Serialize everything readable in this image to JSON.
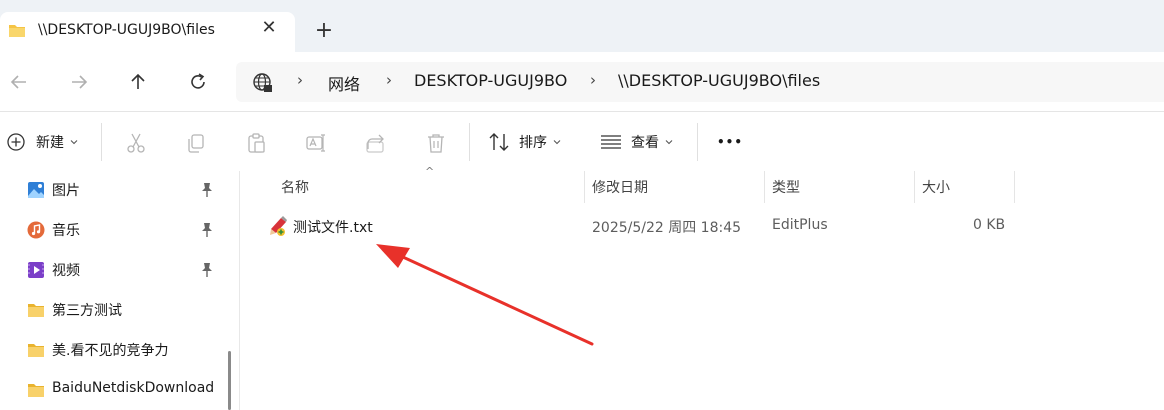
{
  "tab": {
    "title": "\\\\DESKTOP-UGUJ9BO\\files",
    "close_glyph": "✕",
    "new_tab_glyph": "+"
  },
  "nav": {
    "back_icon": "arrow-left-icon",
    "forward_icon": "arrow-right-icon",
    "up_icon": "arrow-up-icon",
    "refresh_icon": "refresh-icon"
  },
  "address": {
    "root_icon": "network-globe-icon",
    "crumbs": [
      "网络",
      "DESKTOP-UGUJ9BO",
      "\\\\DESKTOP-UGUJ9BO\\files"
    ],
    "separator": "›"
  },
  "toolbar": {
    "new_label": "新建",
    "sort_label": "排序",
    "view_label": "查看",
    "more_glyph": "•••",
    "icons": [
      "cut-icon",
      "copy-icon",
      "paste-icon",
      "rename-icon",
      "share-icon",
      "delete-icon"
    ]
  },
  "sidebar": {
    "items": [
      {
        "label": "图片",
        "icon": "pictures-icon",
        "pinned": true
      },
      {
        "label": "音乐",
        "icon": "music-icon",
        "pinned": true
      },
      {
        "label": "视频",
        "icon": "videos-icon",
        "pinned": true
      },
      {
        "label": "第三方测试",
        "icon": "folder-icon",
        "pinned": false
      },
      {
        "label": "美.看不见的竞争力",
        "icon": "folder-icon",
        "pinned": false
      },
      {
        "label": "BaiduNetdiskDownload",
        "icon": "folder-icon",
        "pinned": false
      }
    ]
  },
  "list": {
    "columns": [
      "名称",
      "修改日期",
      "类型",
      "大小"
    ],
    "sort_indicator": "^",
    "rows": [
      {
        "name": "测试文件.txt",
        "modified": "2025/5/22 周四 18:45",
        "type": "EditPlus",
        "size": "0 KB"
      }
    ]
  },
  "colors": {
    "folder": "#f5c445",
    "accent": "#0067c0",
    "annotation_arrow": "#e8312a"
  }
}
